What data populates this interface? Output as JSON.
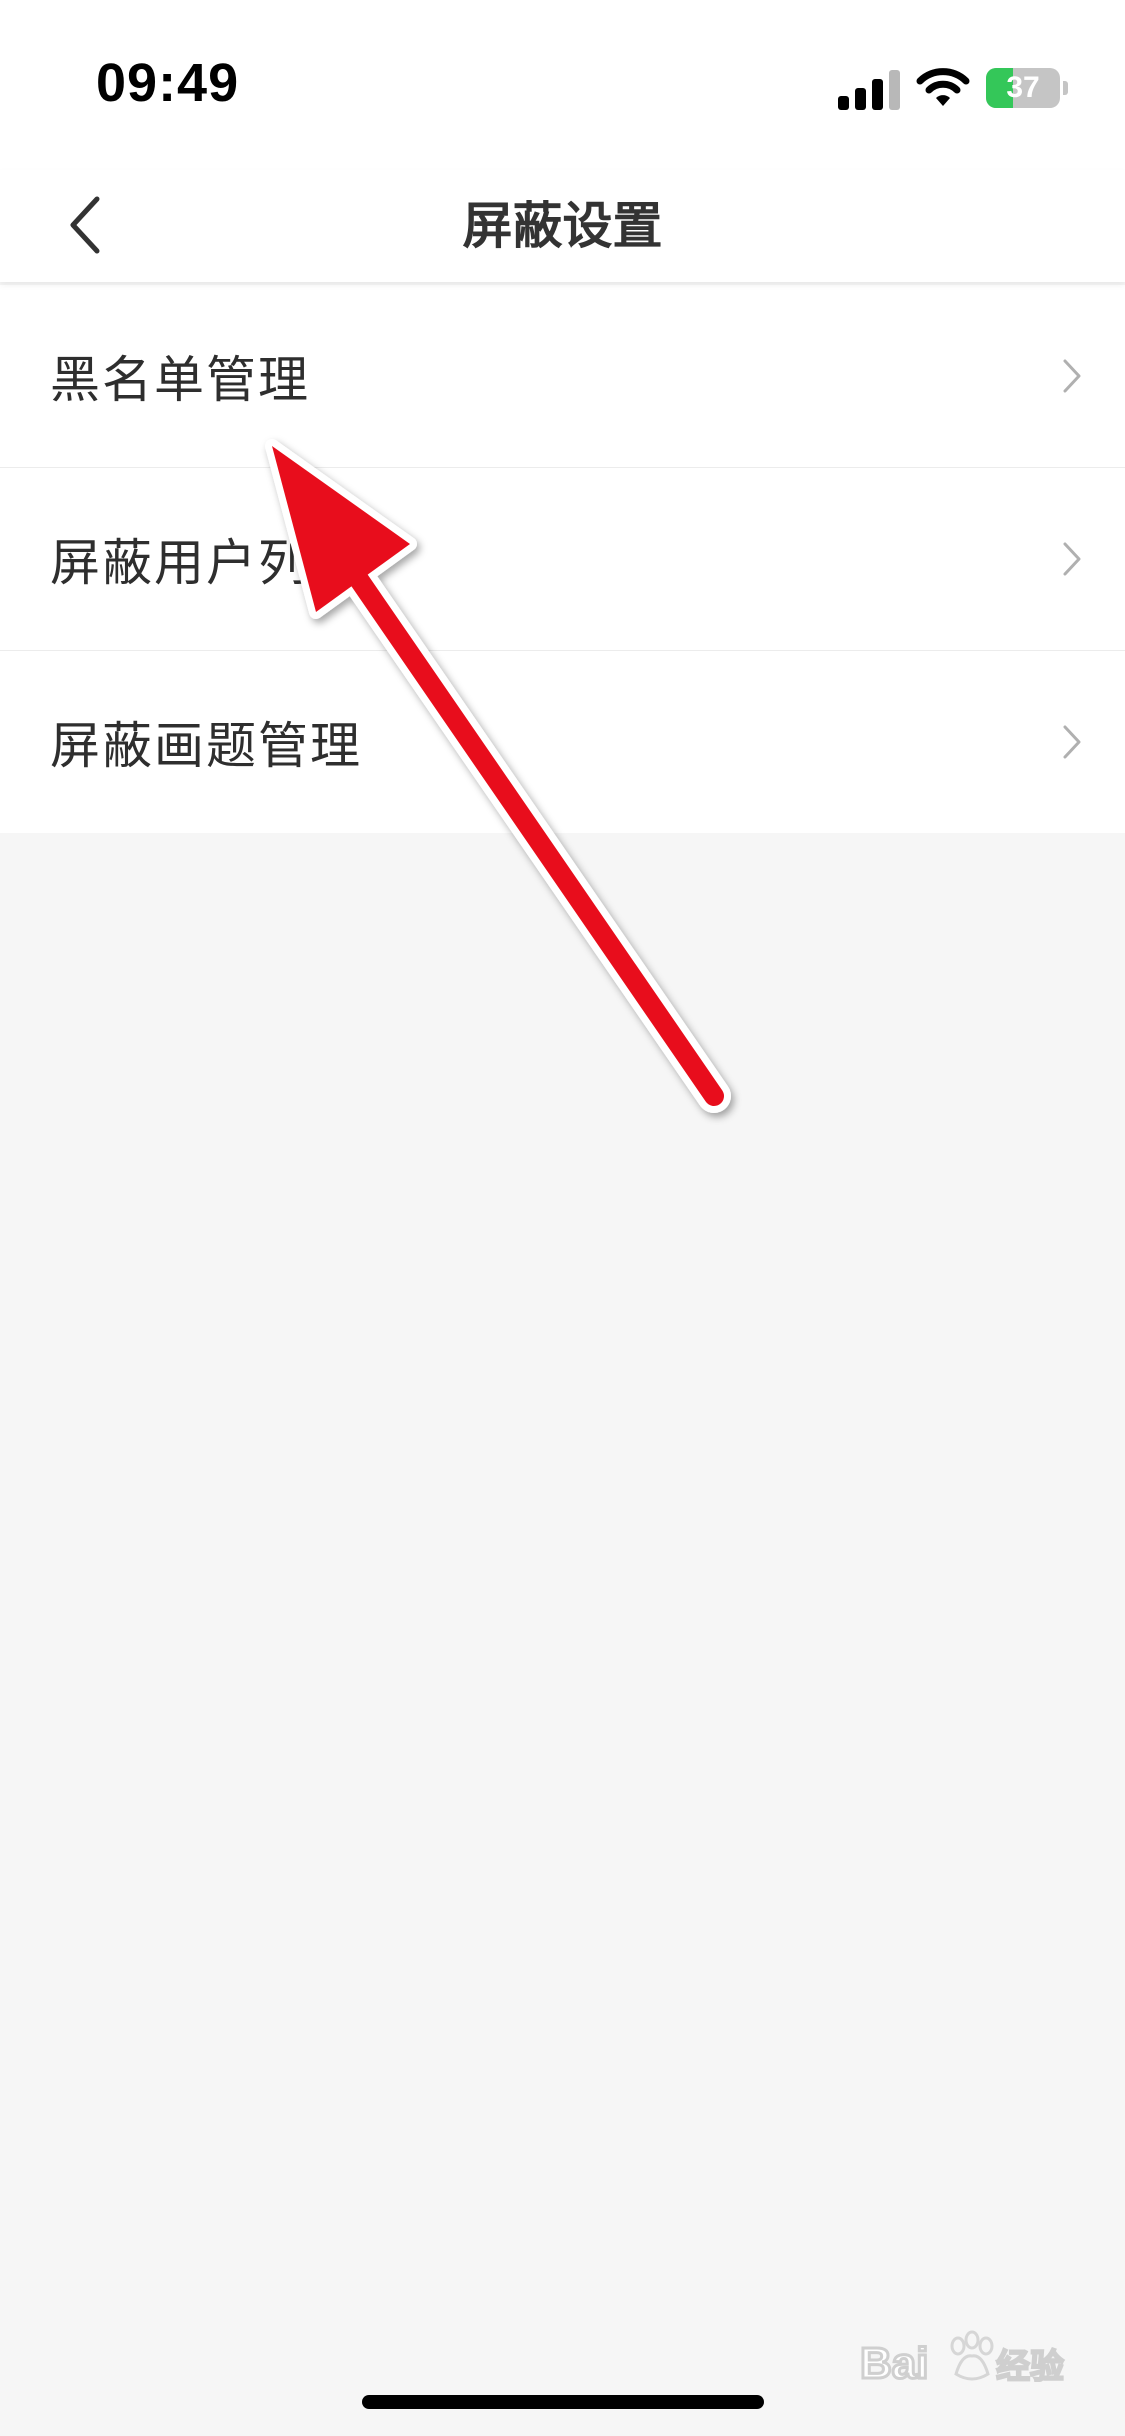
{
  "status_bar": {
    "time": "09:49",
    "battery_level": "37",
    "icons": [
      "signal-icon",
      "wifi-icon",
      "battery-charging-icon"
    ]
  },
  "nav": {
    "title": "屏蔽设置",
    "back_icon": "chevron-left-icon"
  },
  "menu": {
    "items": [
      {
        "label": "黑名单管理"
      },
      {
        "label": "屏蔽用户列表"
      },
      {
        "label": "屏蔽画题管理"
      }
    ],
    "item_icon": "chevron-right-icon"
  },
  "annotation": {
    "arrow_color": "#e8101c"
  },
  "watermark": {
    "text": "Baidu经验"
  },
  "colors": {
    "background": "#f6f6f6",
    "surface": "#ffffff",
    "battery_green": "#34c759"
  }
}
